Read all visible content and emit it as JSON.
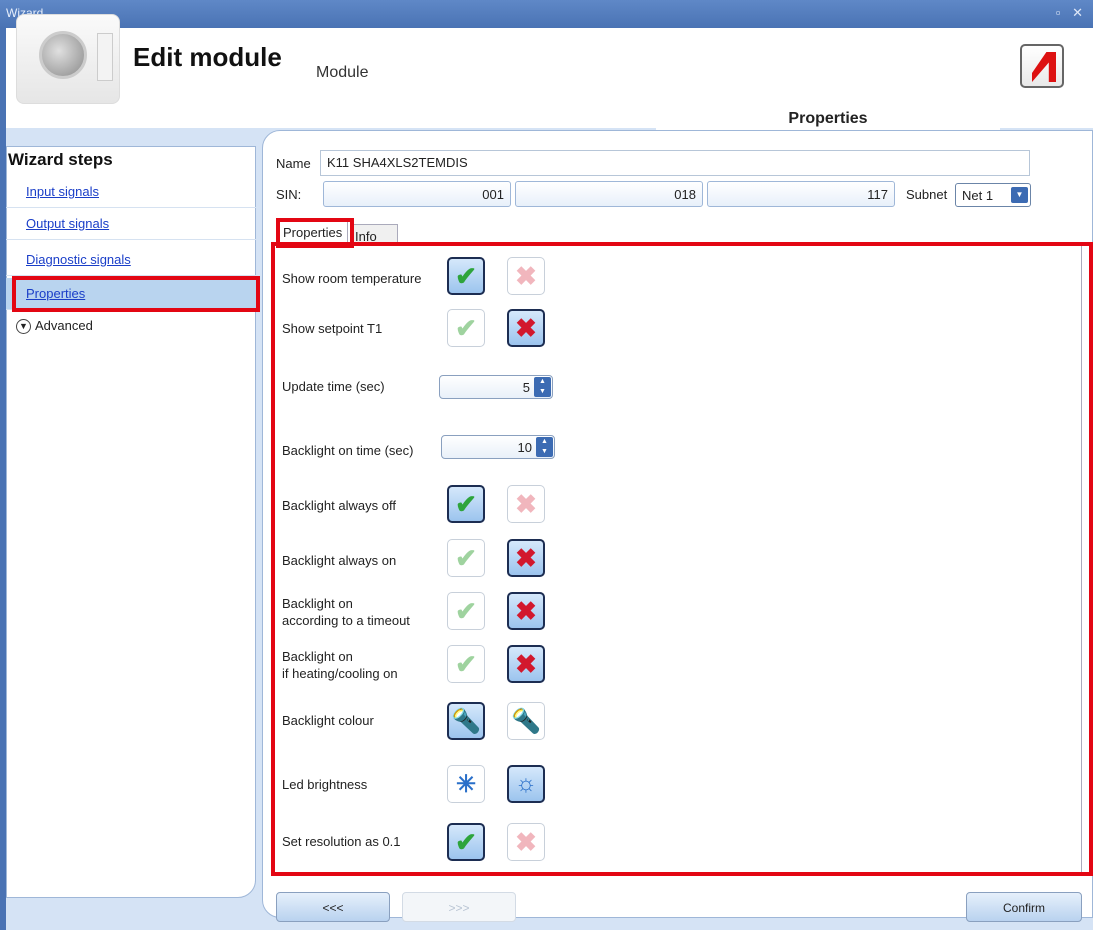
{
  "window": {
    "title": "Wizard...",
    "controls": "▫ ✕"
  },
  "header": {
    "title": "Edit module",
    "subtitle": "Module",
    "section_tab": "Properties"
  },
  "steps": {
    "title": "Wizard steps",
    "items": [
      {
        "label": "Input signals"
      },
      {
        "label": "Output signals"
      },
      {
        "label": "Diagnostic signals"
      },
      {
        "label": "Properties",
        "selected": true
      }
    ],
    "advanced_label": "Advanced"
  },
  "form": {
    "name_label": "Name",
    "name_value": "K11 SHA4XLS2TEMDIS",
    "sin_label": "SIN:",
    "sin_values": [
      "001",
      "018",
      "117"
    ],
    "subnet_label": "Subnet",
    "subnet_value": "Net 1"
  },
  "tabs": [
    {
      "label": "Properties",
      "active": true
    },
    {
      "label": "Info",
      "active": false
    }
  ],
  "properties": {
    "show_room_temperature": {
      "label": "Show room temperature",
      "value": true
    },
    "show_setpoint_t1": {
      "label": "Show setpoint T1",
      "value": false
    },
    "update_time": {
      "label": "Update time (sec)",
      "value": "5"
    },
    "backlight_on_time": {
      "label": "Backlight on time (sec)",
      "value": "10"
    },
    "backlight_always_off": {
      "label": "Backlight always off",
      "value": true
    },
    "backlight_always_on": {
      "label": "Backlight always on",
      "value": false
    },
    "backlight_timeout": {
      "label_line1": "Backlight on",
      "label_line2": "according to a timeout",
      "value": false
    },
    "backlight_heating": {
      "label_line1": "Backlight on",
      "label_line2": "if heating/cooling on",
      "value": false
    },
    "backlight_colour": {
      "label": "Backlight colour",
      "selected": "blue"
    },
    "led_brightness": {
      "label": "Led brightness",
      "selected": "high"
    },
    "set_resolution": {
      "label": "Set resolution as 0.1",
      "value": true
    }
  },
  "nav": {
    "back_label": "<<<",
    "next_label": ">>>",
    "confirm_label": "Confirm"
  },
  "colors": {
    "highlight": "#e30613",
    "titlebar": "#4a73b4",
    "selected_step": "#b9d4ef"
  }
}
